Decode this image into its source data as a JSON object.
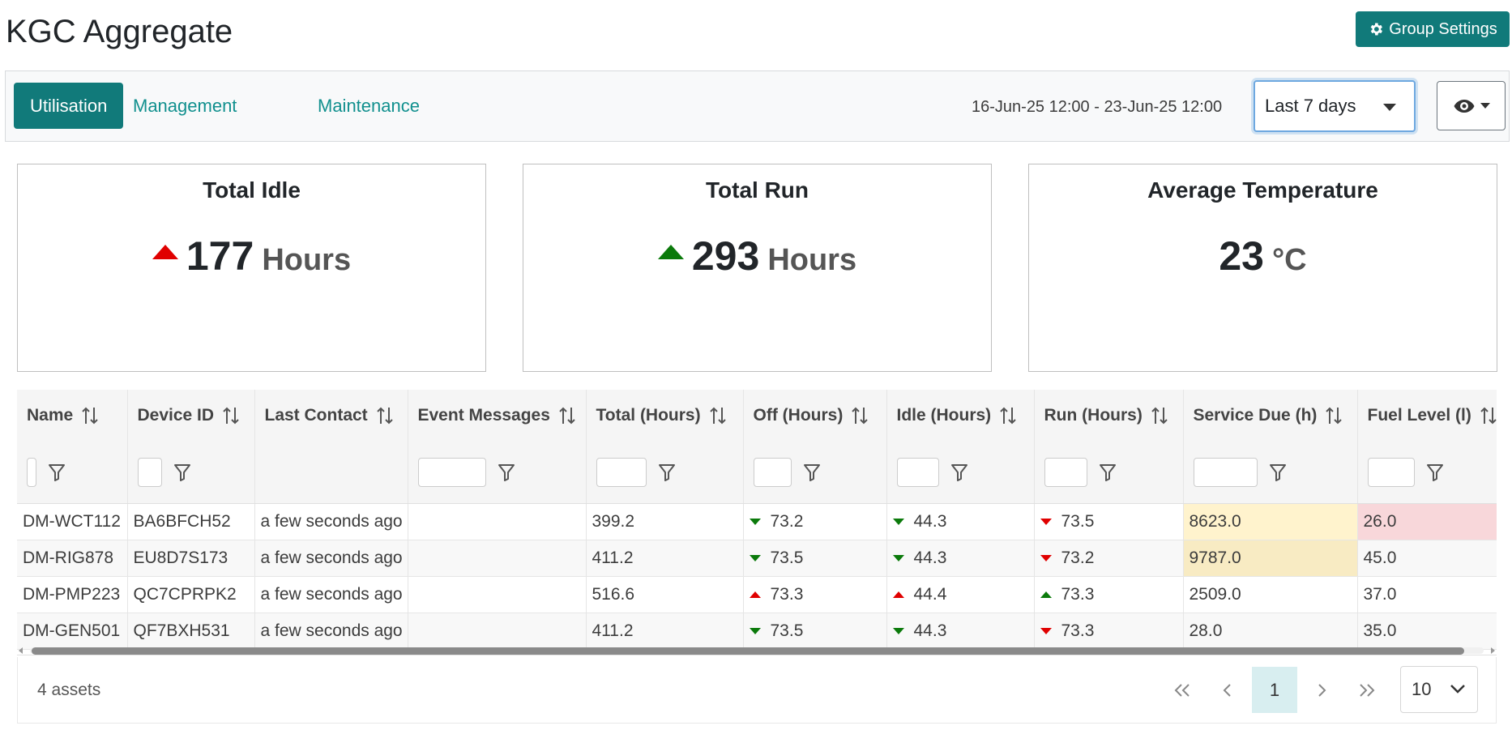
{
  "header": {
    "title": "KGC Aggregate",
    "settings_label": "Group Settings"
  },
  "tabs": [
    {
      "label": "Utilisation",
      "active": true
    },
    {
      "label": "Management",
      "active": false
    },
    {
      "label": "Maintenance",
      "active": false
    }
  ],
  "date_range": "16-Jun-25 12:00 - 23-Jun-25 12:00",
  "range_select": "Last 7 days",
  "cards": [
    {
      "title": "Total Idle",
      "value": "177",
      "unit": "Hours",
      "trend": "up",
      "trend_color": "#e00000"
    },
    {
      "title": "Total Run",
      "value": "293",
      "unit": "Hours",
      "trend": "up",
      "trend_color": "#0b7a0b"
    },
    {
      "title": "Average Temperature",
      "value": "23",
      "unit": "°C"
    }
  ],
  "table": {
    "columns": [
      "Name",
      "Device ID",
      "Last Contact",
      "Event Messages",
      "Total (Hours)",
      "Off (Hours)",
      "Idle (Hours)",
      "Run (Hours)",
      "Service Due (h)",
      "Fuel Level (l)"
    ],
    "rows": [
      [
        "DM-WCT112",
        "BA6BFCH52",
        "a few seconds ago",
        "",
        "399.2",
        "73.2",
        "44.3",
        "73.5",
        "8623.0",
        "26.0"
      ],
      [
        "DM-RIG878",
        "EU8D7S173",
        "a few seconds ago",
        "",
        "411.2",
        "73.5",
        "44.3",
        "73.2",
        "9787.0",
        "45.0"
      ],
      [
        "DM-PMP223",
        "QC7CPRPK2",
        "a few seconds ago",
        "",
        "516.6",
        "73.3",
        "44.4",
        "73.3",
        "2509.0",
        "37.0"
      ],
      [
        "DM-GEN501",
        "QF7BXH531",
        "a few seconds ago",
        "",
        "411.2",
        "73.5",
        "44.3",
        "73.3",
        "28.0",
        "35.0"
      ]
    ],
    "trends": [
      [
        "down",
        "down",
        "down"
      ],
      [
        "down",
        "down",
        "down"
      ],
      [
        "up",
        "up",
        "up"
      ],
      [
        "down",
        "down",
        "down"
      ]
    ],
    "trend_directions_by_row": [
      [
        "down-green",
        "down-green",
        "down-red"
      ],
      [
        "down-green",
        "down-green",
        "down-red"
      ],
      [
        "up-red",
        "up-red",
        "up-green"
      ],
      [
        "down-green",
        "down-green",
        "down-red"
      ]
    ],
    "highlights": {
      "service_due": [
        "warn",
        "warn",
        "none",
        "none"
      ],
      "fuel_level": [
        "danger",
        "none",
        "none",
        "none"
      ]
    }
  },
  "footer": {
    "count": "4 assets",
    "current_page": "1",
    "page_size": "10"
  },
  "colors": {
    "accent": "#117a7a",
    "link": "#11908e",
    "trend_green": "#0b7a0b",
    "trend_red": "#e00000"
  }
}
